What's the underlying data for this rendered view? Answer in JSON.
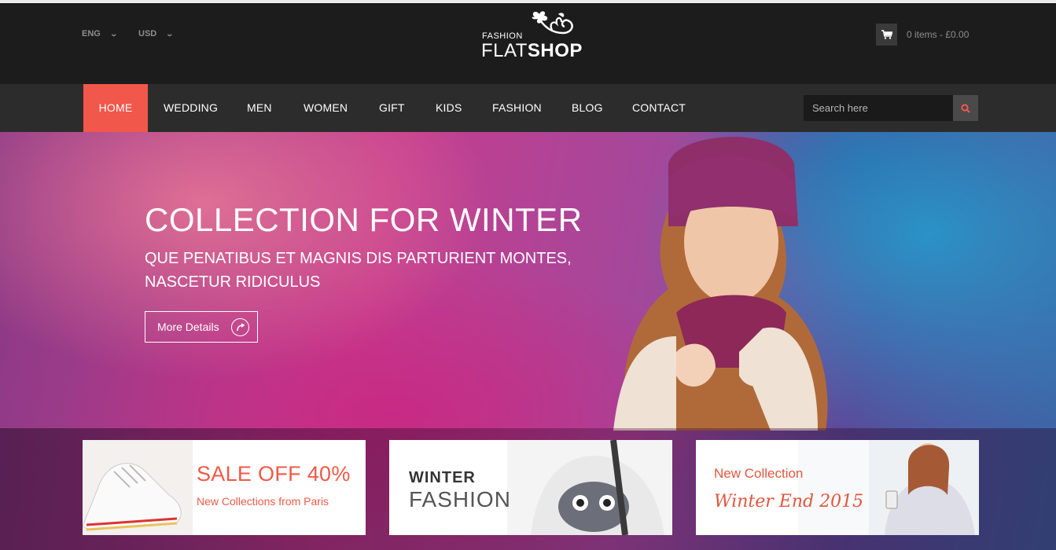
{
  "header": {
    "language": "ENG",
    "currency": "USD",
    "logo": {
      "small": "FASHION",
      "big_light": "FLAT",
      "big_bold": "SHOP"
    },
    "cart": {
      "text": "0 items - £0.00",
      "icon": "cart-icon"
    }
  },
  "nav": {
    "items": [
      {
        "label": "HOME",
        "active": true
      },
      {
        "label": "WEDDING"
      },
      {
        "label": "MEN"
      },
      {
        "label": "WOMEN"
      },
      {
        "label": "GIFT"
      },
      {
        "label": "KIDS"
      },
      {
        "label": "FASHION"
      },
      {
        "label": "BLOG"
      },
      {
        "label": "CONTACT"
      }
    ],
    "search": {
      "placeholder": "Search here",
      "icon": "search-icon"
    },
    "accent_color": "#f1574a"
  },
  "hero": {
    "title": "COLLECTION FOR WINTER",
    "subtitle_line1": "QUE PENATIBUS ET MAGNIS DIS PARTURIENT MONTES,",
    "subtitle_line2": "NASCETUR RIDICULUS",
    "button_label": "More Details",
    "button_icon": "arrow-circle-icon"
  },
  "banners": [
    {
      "title": "SALE OFF 40%",
      "subtitle": "New Collections from Paris"
    },
    {
      "title_line1": "WINTER",
      "title_line2": "FASHION"
    },
    {
      "title_line1": "New Collection",
      "title_line2": "Winter End 2015"
    }
  ]
}
